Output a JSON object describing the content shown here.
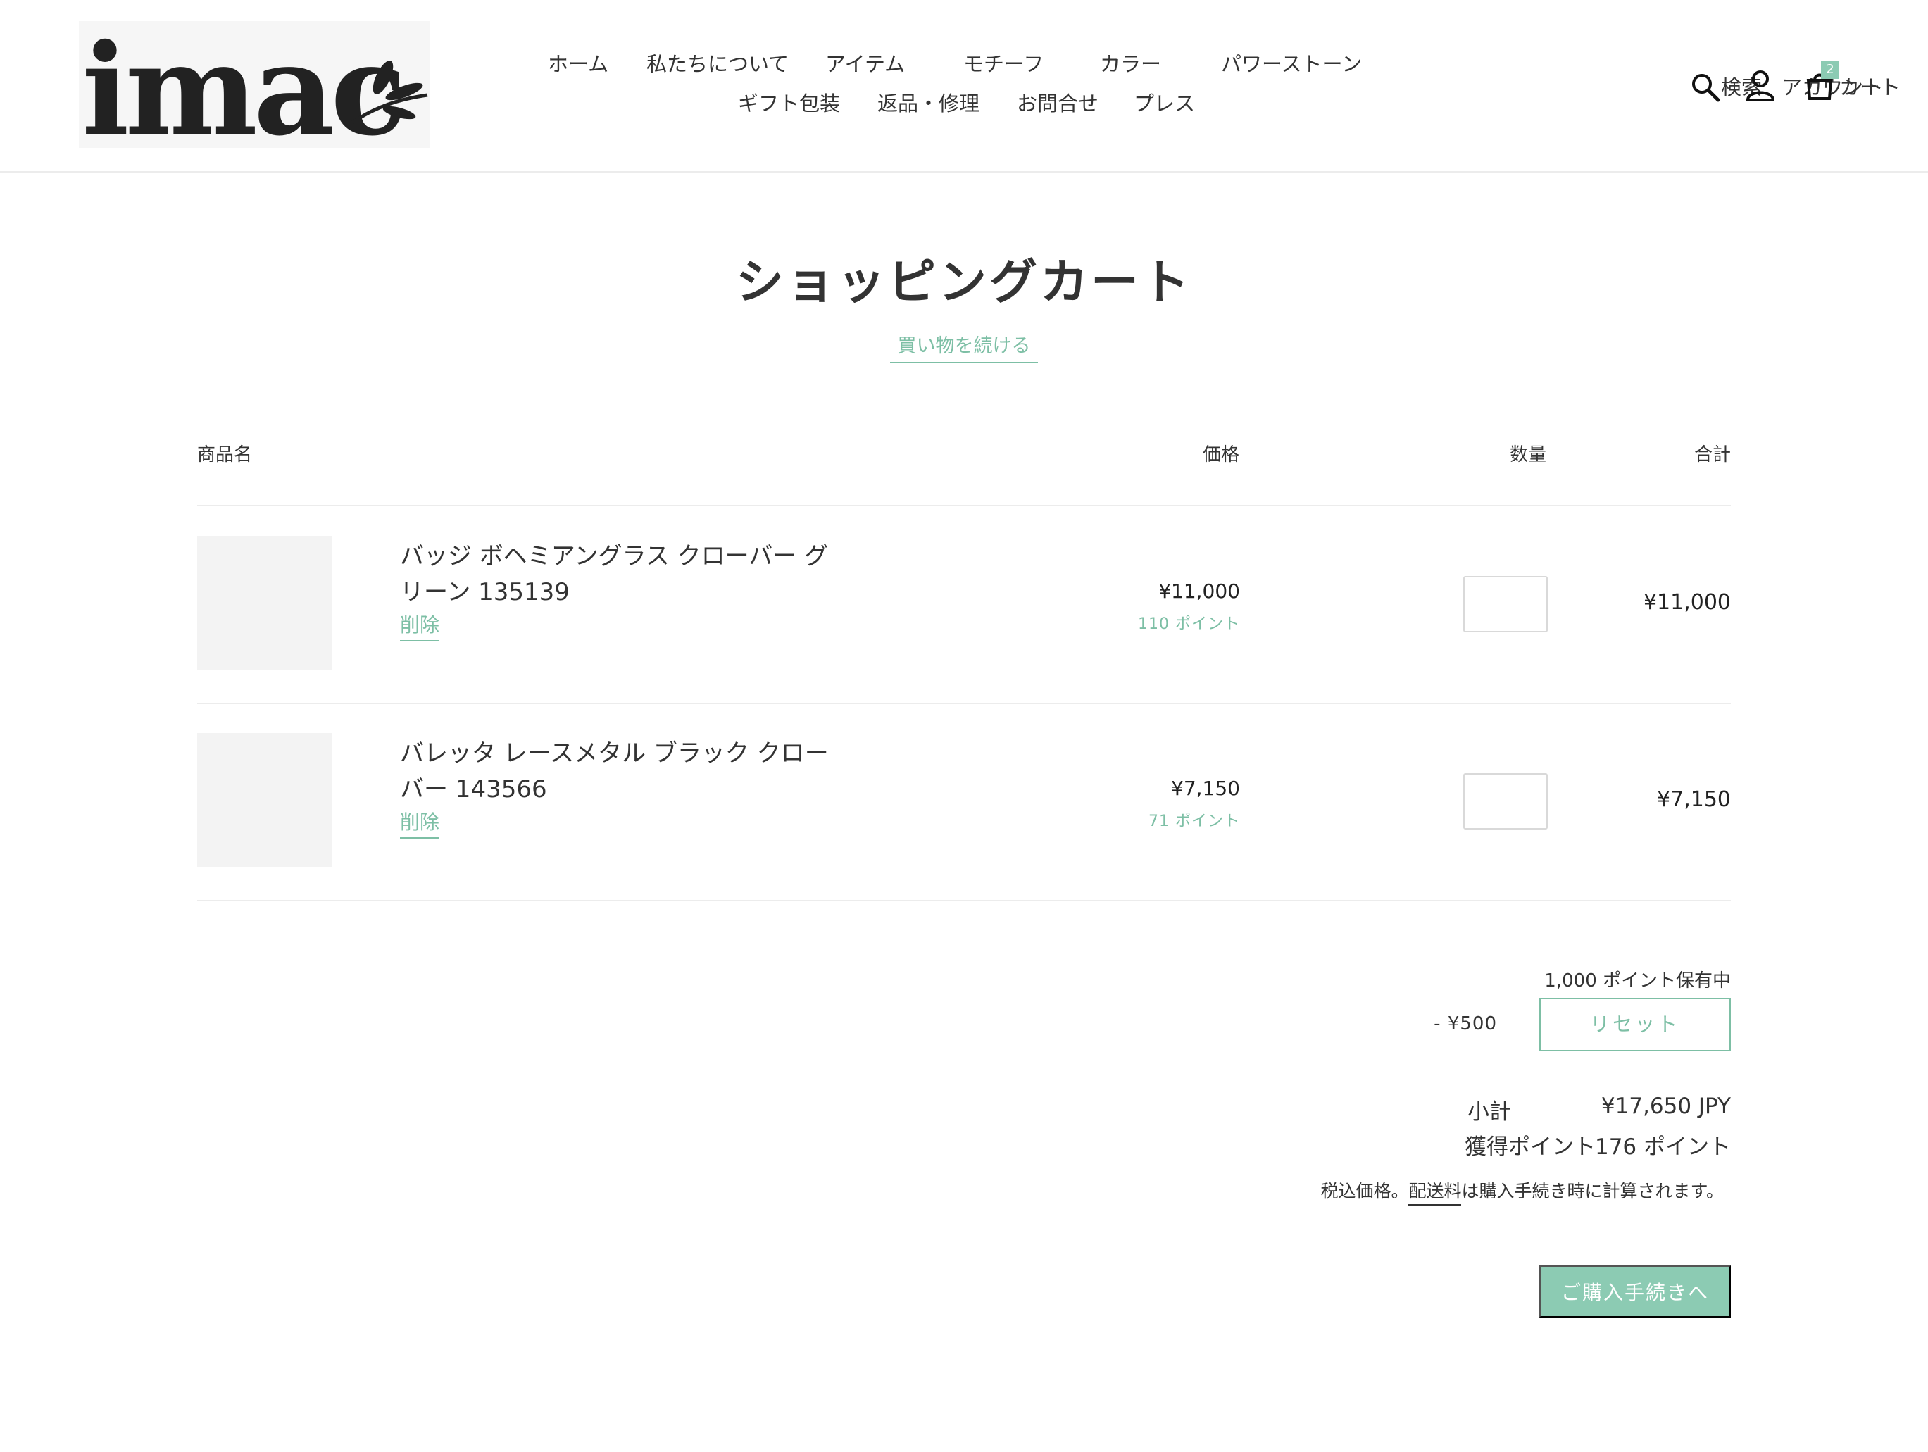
{
  "header": {
    "logo_text": "imac",
    "nav_row1": [
      "ホーム",
      "私たちについて",
      "アイテム",
      "モチーフ",
      "カラー",
      "パワーストーン"
    ],
    "nav_row2": [
      "ギフト包装",
      "返品・修理",
      "お問合せ",
      "プレス"
    ],
    "search_label": "検索",
    "account_label": "アカウント",
    "cart_label": "カート",
    "cart_count": "2",
    "icons": [
      "search-icon",
      "account-icon",
      "cart-icon"
    ]
  },
  "page": {
    "title": "ショッピングカート",
    "continue_link": "買い物を続ける"
  },
  "table": {
    "headers": {
      "product": "商品名",
      "price": "価格",
      "quantity": "数量",
      "total": "合計"
    },
    "items": [
      {
        "name": "バッジ ボヘミアングラス クローバー グリーン 135139",
        "remove_label": "削除",
        "price": "¥11,000",
        "points": "110 ポイント",
        "total": "¥11,000"
      },
      {
        "name": "バレッタ レースメタル ブラック クローバー 143566",
        "remove_label": "削除",
        "price": "¥7,150",
        "points": "71 ポイント",
        "total": "¥7,150"
      }
    ]
  },
  "summary": {
    "points_held": "1,000 ポイント保有中",
    "discount": "- ¥500",
    "reset_label": "リセット",
    "subtotal_label": "小計",
    "subtotal_value": "¥17,650 JPY",
    "earned_label": "獲得ポイント",
    "earned_value": "176 ポイント",
    "tax_prefix": "税込価格。",
    "shipping_link": "配送料",
    "tax_suffix": "は購入手続き時に計算されます。",
    "checkout_label": "ご購入手続きへ"
  },
  "colors": {
    "accent": "#7dbfa5",
    "button_fill": "#8ccbb3",
    "text": "#333333",
    "divider": "#ececec"
  }
}
